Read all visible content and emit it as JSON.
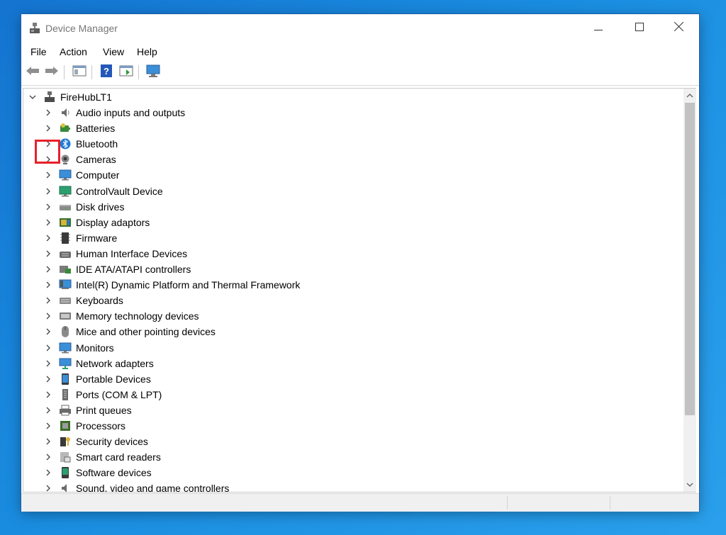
{
  "window": {
    "title": "Device Manager"
  },
  "menu": [
    "File",
    "Action",
    "View",
    "Help"
  ],
  "tree": {
    "root": "FireHubLT1",
    "items": [
      {
        "label": "Audio inputs and outputs",
        "icon": "speaker-icon"
      },
      {
        "label": "Batteries",
        "icon": "battery-icon"
      },
      {
        "label": "Bluetooth",
        "icon": "bluetooth-icon"
      },
      {
        "label": "Cameras",
        "icon": "camera-icon"
      },
      {
        "label": "Computer",
        "icon": "computer-icon"
      },
      {
        "label": "ControlVault Device",
        "icon": "controlvault-icon"
      },
      {
        "label": "Disk drives",
        "icon": "disk-drive-icon"
      },
      {
        "label": "Display adaptors",
        "icon": "display-adapter-icon"
      },
      {
        "label": "Firmware",
        "icon": "firmware-icon"
      },
      {
        "label": "Human Interface Devices",
        "icon": "hid-icon"
      },
      {
        "label": "IDE ATA/ATAPI controllers",
        "icon": "ide-controller-icon"
      },
      {
        "label": "Intel(R) Dynamic Platform and Thermal Framework",
        "icon": "thermal-framework-icon"
      },
      {
        "label": "Keyboards",
        "icon": "keyboard-icon"
      },
      {
        "label": "Memory technology devices",
        "icon": "memory-icon"
      },
      {
        "label": "Mice and other pointing devices",
        "icon": "mouse-icon"
      },
      {
        "label": "Monitors",
        "icon": "monitor-icon"
      },
      {
        "label": "Network adapters",
        "icon": "network-adapter-icon"
      },
      {
        "label": "Portable Devices",
        "icon": "portable-device-icon"
      },
      {
        "label": "Ports (COM & LPT)",
        "icon": "port-icon"
      },
      {
        "label": "Print queues",
        "icon": "printer-icon"
      },
      {
        "label": "Processors",
        "icon": "processor-icon"
      },
      {
        "label": "Security devices",
        "icon": "security-icon"
      },
      {
        "label": "Smart card readers",
        "icon": "smart-card-icon"
      },
      {
        "label": "Software devices",
        "icon": "software-device-icon"
      },
      {
        "label": "Sound, video and game controllers",
        "icon": "sound-controller-icon"
      }
    ]
  },
  "colors": {
    "highlight": "#e8202a",
    "desktop": "#1a8de0"
  }
}
